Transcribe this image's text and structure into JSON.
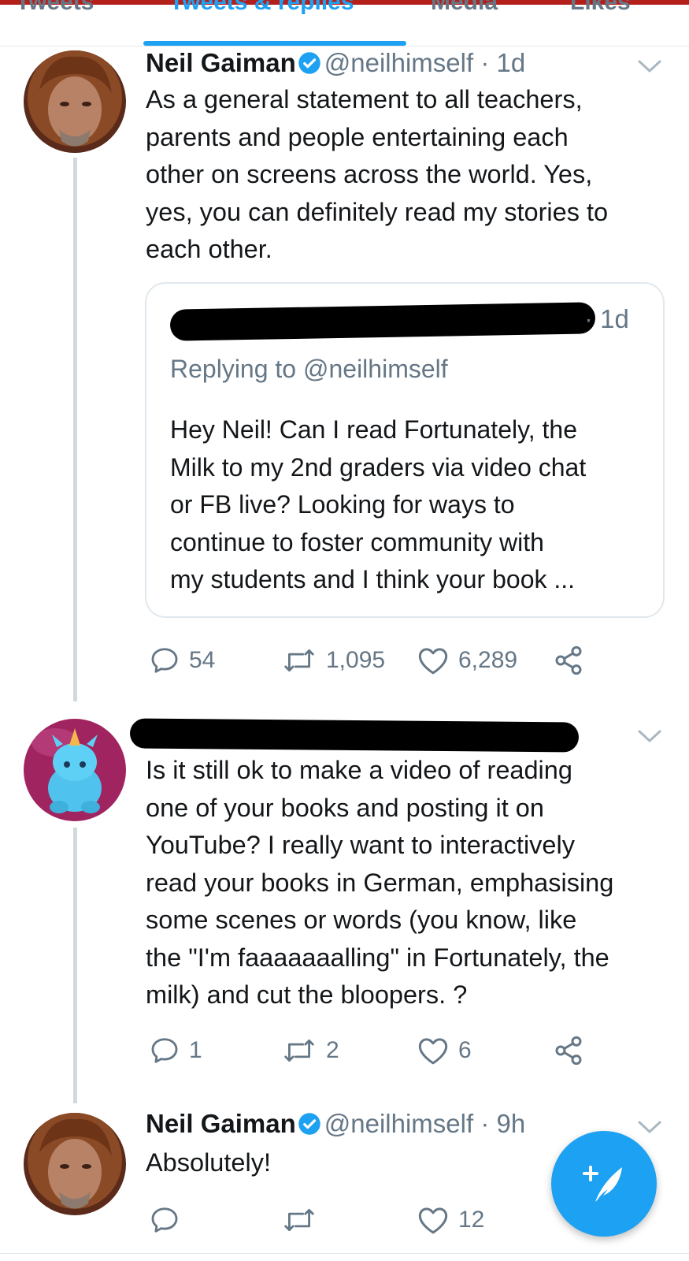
{
  "tabs": [
    "Tweets",
    "Tweets & replies",
    "Media",
    "Likes"
  ],
  "tweet1": {
    "name": "Neil Gaiman",
    "handle": "@neilhimself",
    "time": "· 1d",
    "lines": [
      "As a general statement to all teachers,",
      "parents and people entertaining each",
      "other on screens across the world. Yes,",
      "yes, you can definitely read my stories to",
      "each other."
    ],
    "quote": {
      "time": "· 1d",
      "replying": "Replying to @neilhimself",
      "lines": [
        "Hey Neil! Can I read Fortunately, the",
        "Milk to my 2nd graders via video chat",
        "or FB live? Looking for ways to",
        "continue to foster community with",
        "my students and I think your book ..."
      ]
    },
    "replies": "54",
    "retweets": "1,095",
    "likes": "6,289"
  },
  "tweet2": {
    "lines": [
      "Is it still ok to make a video of reading",
      "one of your books and posting it on",
      "YouTube? I really want to interactively",
      "read your books in German, emphasising",
      "some scenes or words (you know, like",
      "the \"I'm faaaaaaalling\" in Fortunately, the",
      "milk) and cut the bloopers. ?"
    ],
    "replies": "1",
    "retweets": "2",
    "likes": "6"
  },
  "tweet3": {
    "name": "Neil Gaiman",
    "handle": "@neilhimself",
    "time": "· 9h",
    "text": "Absolutely!",
    "likes": "12"
  },
  "colors": {
    "accent": "#1da1f2",
    "muted": "#657786",
    "divider": "#e1e8ed"
  }
}
